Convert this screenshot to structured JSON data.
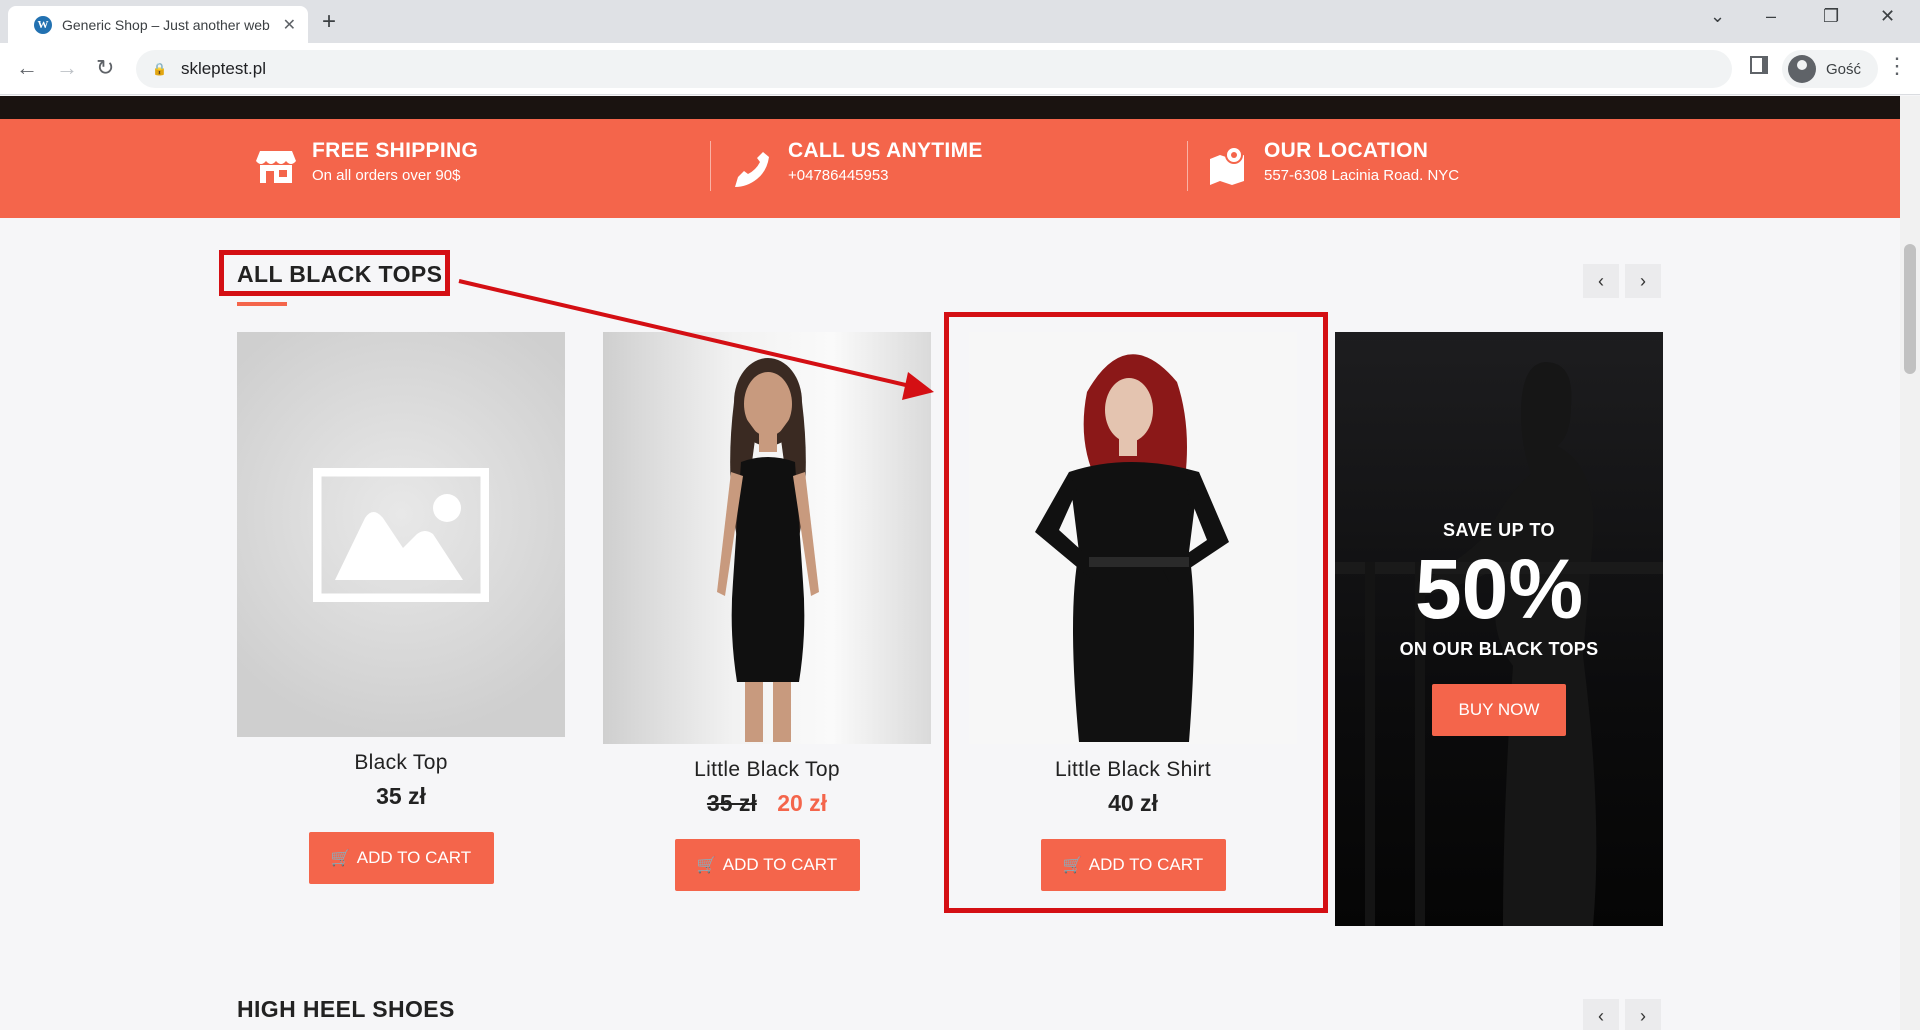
{
  "browser": {
    "tab_title": "Generic Shop – Just another web",
    "tab_favicon": "wordpress-icon",
    "url": "skleptest.pl",
    "profile_label": "Gość"
  },
  "features": [
    {
      "title": "FREE SHIPPING",
      "subtitle": "On all orders over 90$",
      "icon": "store-icon"
    },
    {
      "title": "CALL US ANYTIME",
      "subtitle": "+04786445953",
      "icon": "phone-icon"
    },
    {
      "title": "OUR LOCATION",
      "subtitle": "557-6308 Lacinia Road. NYC",
      "icon": "map-icon"
    }
  ],
  "section1": {
    "title": "ALL BLACK TOPS",
    "products": [
      {
        "name": "Black Top",
        "price": "35 zł",
        "button": "ADD TO CART"
      },
      {
        "name": "Little Black Top",
        "old_price": "35 zł",
        "new_price": "20 zł",
        "button": "ADD TO CART"
      },
      {
        "name": "Little Black Shirt",
        "price": "40 zł",
        "button": "ADD TO CART"
      }
    ],
    "promo": {
      "line1": "SAVE UP TO",
      "big": "50%",
      "line2": "ON OUR BLACK TOPS",
      "button": "BUY NOW"
    }
  },
  "section2": {
    "title": "HIGH HEEL SHOES"
  },
  "colors": {
    "accent": "#f4654b",
    "annotation": "#d40f14"
  }
}
